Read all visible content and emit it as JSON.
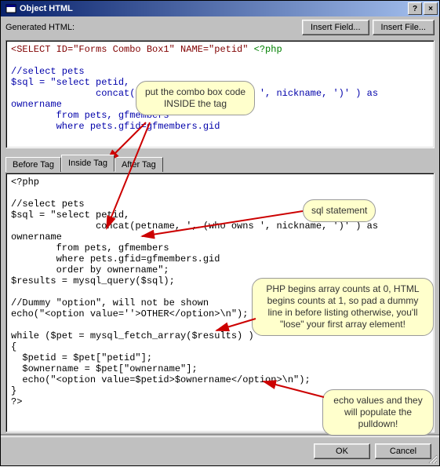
{
  "window": {
    "title": "Object HTML"
  },
  "toolbar": {
    "label": "Generated HTML:",
    "insert_field": "Insert Field...",
    "insert_file": "Insert File..."
  },
  "tabs": {
    "before": "Before Tag",
    "inside": "Inside Tag",
    "after": "After Tag"
  },
  "top_code": {
    "l1a": "<SELECT ID=\"Forms Combo Box1\" NAME=\"petid\" ",
    "l1b": "<?php",
    "l2": "",
    "l3": "//select pets",
    "l4": "$sql = \"select petid,",
    "l5": "               concat(petname, ', (who owns ', nickname, ')' ) as",
    "l6": "ownername",
    "l7": "        from pets, gfmembers",
    "l8": "        where pets.gfid=gfmembers.gid"
  },
  "bot_code": {
    "l1": "<?php",
    "l2": "",
    "l3": "//select pets",
    "l4": "$sql = \"select petid,",
    "l5": "               concat(petname, ', (who owns ', nickname, ')' ) as",
    "l6": "ownername",
    "l7": "        from pets, gfmembers",
    "l8": "        where pets.gfid=gfmembers.gid",
    "l9": "        order by ownername\";",
    "l10": "$results = mysql_query($sql);",
    "l11": "",
    "l12": "//Dummy \"option\", will not be shown",
    "l13": "echo(\"<option value=''>OTHER</option>\\n\");",
    "l14": "",
    "l15": "while ($pet = mysql_fetch_array($results) )",
    "l16": "{",
    "l17": "  $petid = $pet[\"petid\"];",
    "l18": "  $ownername = $pet[\"ownername\"];",
    "l19": "  echo(\"<option value=$petid>$ownername</option>\\n\");",
    "l20": "}",
    "l21": "?>"
  },
  "callouts": {
    "c1": "put the combo\nbox code INSIDE\nthe tag",
    "c2": "sql statement",
    "c3": "PHP begins array counts at 0,\nHTML begins counts at 1, so\npad a dummy line in before listing\notherwise, you'll \"lose\" your first\narray element!",
    "c4": "echo values and\nthey will populate\nthe pulldown!"
  },
  "buttons": {
    "ok": "OK",
    "cancel": "Cancel"
  }
}
